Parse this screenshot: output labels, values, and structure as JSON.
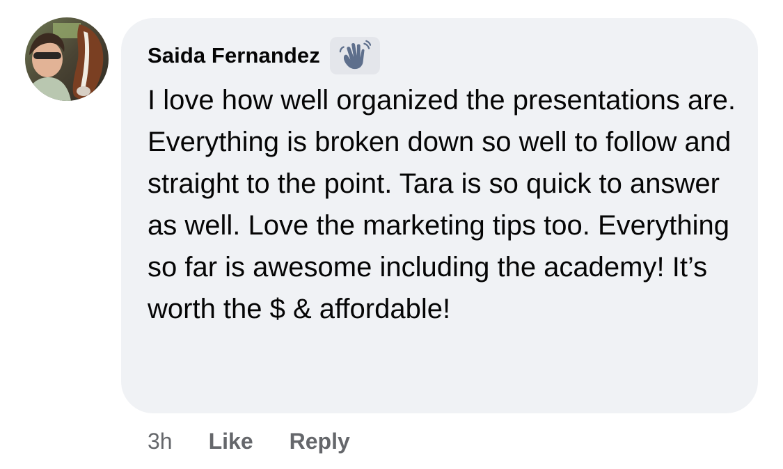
{
  "comment": {
    "author": "Saida Fernandez",
    "badge_icon": "waving-hand-icon",
    "text": "I love how well organized the presentations are. Everything is broken down so well to follow and straight to the point. Tara is so quick to answer as well. Love the marketing tips too. Everything so far is awesome including the academy! It’s worth the $ & affordable!",
    "timestamp": "3h"
  },
  "actions": {
    "like_label": "Like",
    "reply_label": "Reply"
  },
  "colors": {
    "bubble_background": "#f0f2f5",
    "badge_background": "#e4e6eb",
    "secondary_text": "#65676b",
    "primary_text": "#050505"
  }
}
